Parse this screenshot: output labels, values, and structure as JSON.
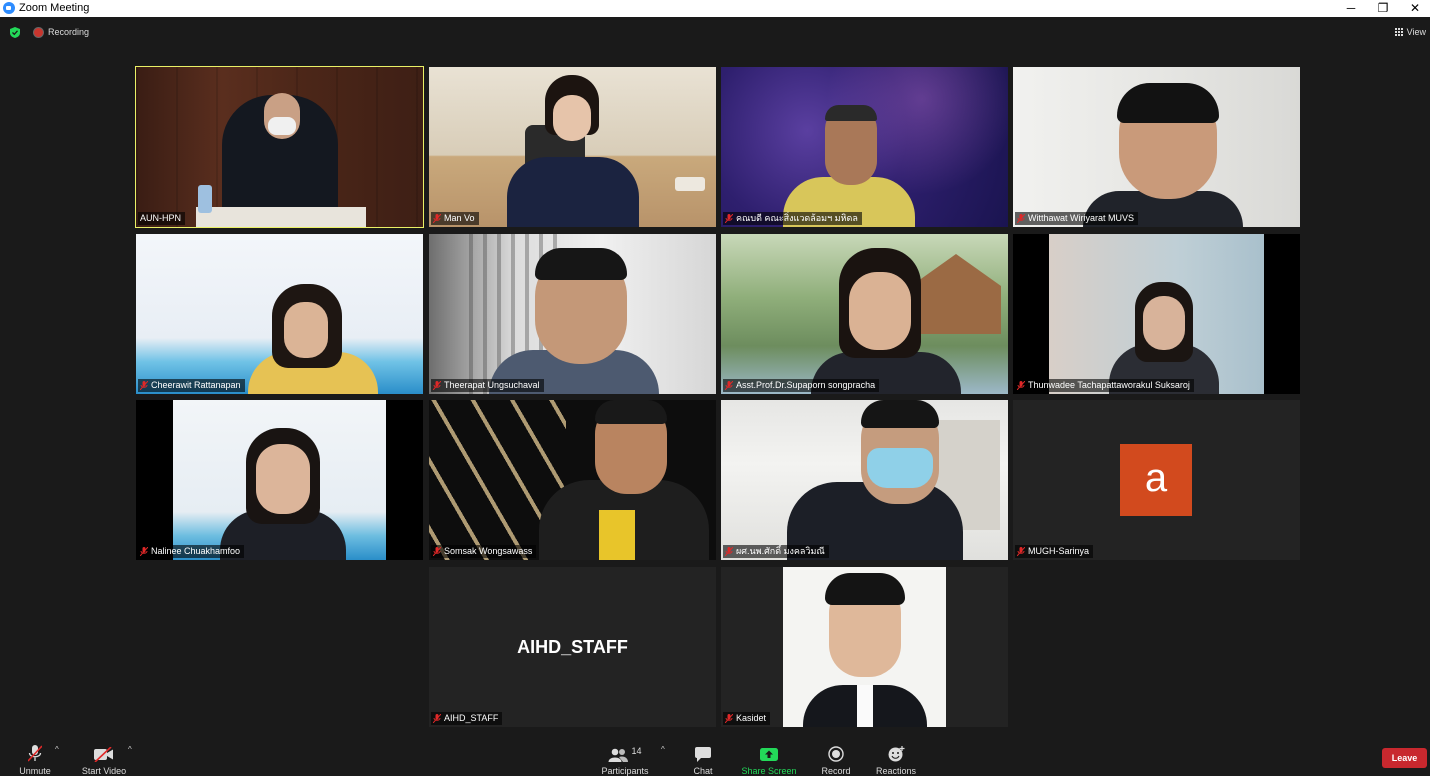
{
  "window": {
    "title": "Zoom Meeting",
    "minimize": "─",
    "restore": "❐",
    "close": "✕"
  },
  "status": {
    "recording": "Recording",
    "view": "View"
  },
  "participants": [
    {
      "name": "AUN-HPN",
      "muted": false,
      "active": true
    },
    {
      "name": "Man Vo",
      "muted": true
    },
    {
      "name": "คณบดี คณะสิ่งแวดล้อมฯ มหิดล",
      "muted": true
    },
    {
      "name": "Witthawat Wiriyarat MUVS",
      "muted": true
    },
    {
      "name": "Cheerawit Rattanapan",
      "muted": true
    },
    {
      "name": "Theerapat Ungsuchaval",
      "muted": true
    },
    {
      "name": "Asst.Prof.Dr.Supaporn songpracha",
      "muted": true
    },
    {
      "name": "Thunwadee Tachapattaworakul Suksaroj",
      "muted": true
    },
    {
      "name": "Nalinee Chuakhamfoo",
      "muted": true
    },
    {
      "name": "Somsak Wongsawass",
      "muted": true
    },
    {
      "name": "ผศ.นพ.ศักดิ์ มงคลวิมณี",
      "muted": true
    },
    {
      "name": "MUGH-Sarinya",
      "muted": true,
      "avatar_letter": "a"
    },
    {
      "name": "AIHD_STAFF",
      "muted": true,
      "display_text": "AIHD_STAFF"
    },
    {
      "name": "Kasidet",
      "muted": true
    }
  ],
  "toolbar": {
    "unmute": "Unmute",
    "start_video": "Start Video",
    "participants_count": "14",
    "participants": "Participants",
    "chat": "Chat",
    "share_screen": "Share Screen",
    "record": "Record",
    "reactions": "Reactions",
    "leave": "Leave"
  },
  "colors": {
    "active_speaker_border": "#e9f066",
    "share_green": "#23d959",
    "leave_red": "#c8282e",
    "avatar_orange": "#d24a1e"
  }
}
